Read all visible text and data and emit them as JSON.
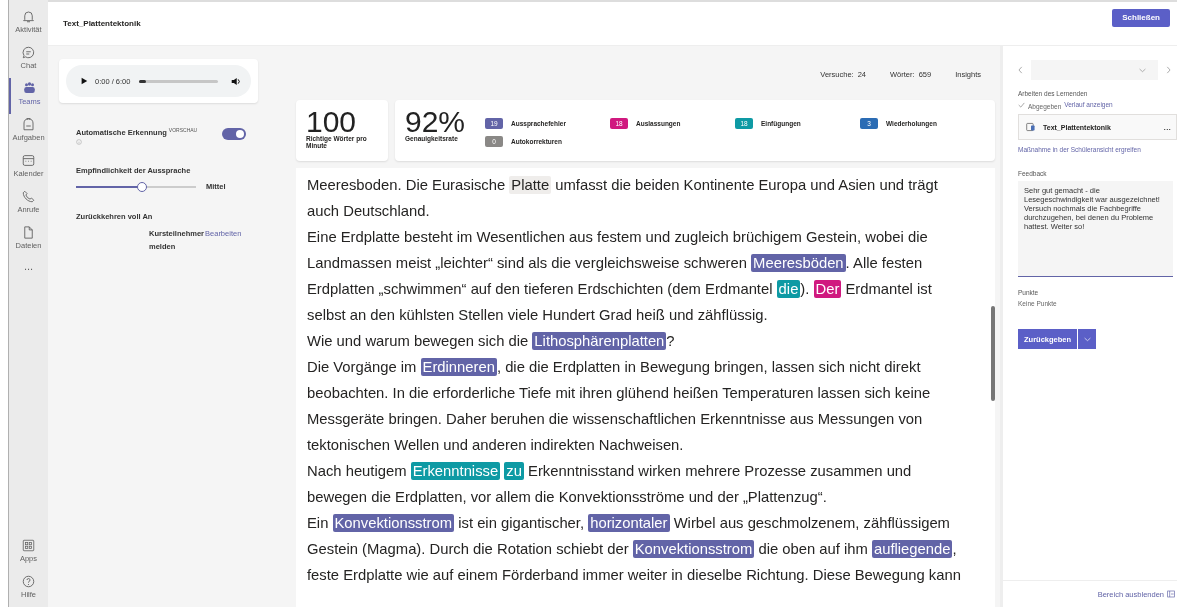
{
  "rail": {
    "items": [
      {
        "label": "Aktivität",
        "selected": false
      },
      {
        "label": "Chat",
        "selected": false
      },
      {
        "label": "Teams",
        "selected": true
      },
      {
        "label": "Aufgaben",
        "selected": false
      },
      {
        "label": "Kalender",
        "selected": false
      },
      {
        "label": "Anrufe",
        "selected": false
      },
      {
        "label": "Dateien",
        "selected": false
      }
    ],
    "more": "...",
    "bottom_items": [
      {
        "label": "Apps",
        "selected": false
      },
      {
        "label": "Hilfe",
        "selected": false
      }
    ]
  },
  "header": {
    "title": "Text_Plattentektonik",
    "close_button": "Schließen"
  },
  "audio": {
    "time": "0:00 / 6:00",
    "level": 0.08
  },
  "settings": {
    "auto_label": "Automatische Erkennung",
    "auto_badge": "VORSCHAU",
    "auto_on": true,
    "sensitivity": {
      "label": "Empfindlichkeit der Aussprache",
      "level": 0.55,
      "value": "Mittel"
    },
    "return_label": "Zurückkehren voll An",
    "return_word": "Kursteilnehmer",
    "edit_link": "Bearbeiten",
    "return_word2": "melden"
  },
  "stats": {
    "attempts_label": "Versuche:",
    "attempts": "24",
    "words_label": "Wörter:",
    "words": "659",
    "insights": "Insights"
  },
  "wpm": {
    "value": "100",
    "label": "Richtige Wörter pro Minute"
  },
  "accuracy": {
    "value": "92%",
    "label": "Genauigkeitsrate"
  },
  "categories": [
    {
      "kind": "pron",
      "count": "19",
      "label": "Aussprachefehler",
      "color": "#6264a7"
    },
    {
      "kind": "omit",
      "count": "18",
      "label": "Auslassungen",
      "color": "#d0197f"
    },
    {
      "kind": "ins",
      "count": "18",
      "label": "Einfügungen",
      "color": "#0e9aa4"
    },
    {
      "kind": "rep",
      "count": "3",
      "label": "Wiederholungen",
      "color": "#2b6cb4"
    },
    {
      "kind": "auto",
      "count": "0",
      "label": "Autokorrekturen",
      "color": "#8a8886"
    }
  ],
  "paragraphs": [
    [
      {
        "kind": "plain",
        "text": "Meeresboden. Die Eurasische "
      },
      {
        "kind": "hover",
        "text": "Platte"
      },
      {
        "kind": "plain",
        "text": " umfasst die beiden Kontinente Europa und Asien und trägt auch Deutschland."
      }
    ],
    [
      {
        "kind": "plain",
        "text": "Eine Erdplatte besteht im Wesentlichen aus festem und zugleich brüchigem Gestein, wobei die Landmassen meist „leichter“ sind als die vergleichsweise schweren "
      },
      {
        "kind": "pron",
        "text": "Meeresböden"
      },
      {
        "kind": "plain",
        "text": ". Alle festen Erdplatten „schwimmen“ auf den tieferen Erdschichten (dem Erdmantel "
      },
      {
        "kind": "ins",
        "text": "die"
      },
      {
        "kind": "plain",
        "text": "). "
      },
      {
        "kind": "omit",
        "text": "Der"
      },
      {
        "kind": "plain",
        "text": " Erdmantel ist selbst an den kühlsten Stellen viele Hundert Grad heiß und zähflüssig."
      }
    ],
    [
      {
        "kind": "plain",
        "text": "Wie und warum bewegen sich die "
      },
      {
        "kind": "pron",
        "text": "Lithosphärenplatten"
      },
      {
        "kind": "plain",
        "text": "?"
      }
    ],
    [
      {
        "kind": "plain",
        "text": "Die Vorgänge im "
      },
      {
        "kind": "pron",
        "text": "Erdinneren"
      },
      {
        "kind": "plain",
        "text": ", die die Erdplatten in Bewegung bringen, lassen sich nicht direkt beobachten. In die erforderliche Tiefe mit ihren glühend heißen Temperaturen lassen sich keine Messgeräte bringen. Daher beruhen die wissenschaftlichen Erkenntnisse aus Messungen von tektonischen Wellen und anderen indirekten Nachweisen."
      }
    ],
    [
      {
        "kind": "plain",
        "text": "Nach heutigem "
      },
      {
        "kind": "ins",
        "text": "Erkenntnisse"
      },
      {
        "kind": "ins",
        "text": "zu"
      },
      {
        "kind": "plain",
        "text": " Erkenntnisstand wirken mehrere Prozesse zusammen und bewegen die Erdplatten, vor allem die Konvektionsströme und der „Plattenzug“."
      }
    ],
    [
      {
        "kind": "plain",
        "text": "Ein "
      },
      {
        "kind": "pron",
        "text": "Konvektionsstrom"
      },
      {
        "kind": "plain",
        "text": " ist ein gigantischer, "
      },
      {
        "kind": "pron",
        "text": "horizontaler"
      },
      {
        "kind": "plain",
        "text": " Wirbel aus geschmolzenem, zähflüssigem Gestein (Magma). Durch die Rotation schiebt der "
      },
      {
        "kind": "pron",
        "text": "Konvektionsstrom"
      },
      {
        "kind": "plain",
        "text": " die oben auf ihm "
      },
      {
        "kind": "pron",
        "text": "aufliegende"
      },
      {
        "kind": "plain",
        "text": ", feste Erdplatte wie auf einem Förderband immer weiter in dieselbe Richtung. Diese Bewegung kann"
      }
    ]
  ],
  "right": {
    "work_label": "Arbeiten des Lernenden",
    "status": "Abgegeben",
    "history_link": "Verlauf anzeigen",
    "file_name": "Text_Plattentektonik",
    "file_more": "...",
    "action_link": "Maßnahme in der Schüleransicht ergreifen",
    "feedback_label": "Feedback",
    "feedback": "Sehr gut gemacht - die Lesegeschwindigkeit war ausgezeichnet! Versuch nochmals die Fachbegriffe durchzugehen, bei denen du Probleme hattest. Weiter so!",
    "points_label": "Punkte",
    "points": "Keine Punkte",
    "return_button": "Zurückgeben",
    "hide_link": "Bereich ausblenden"
  }
}
